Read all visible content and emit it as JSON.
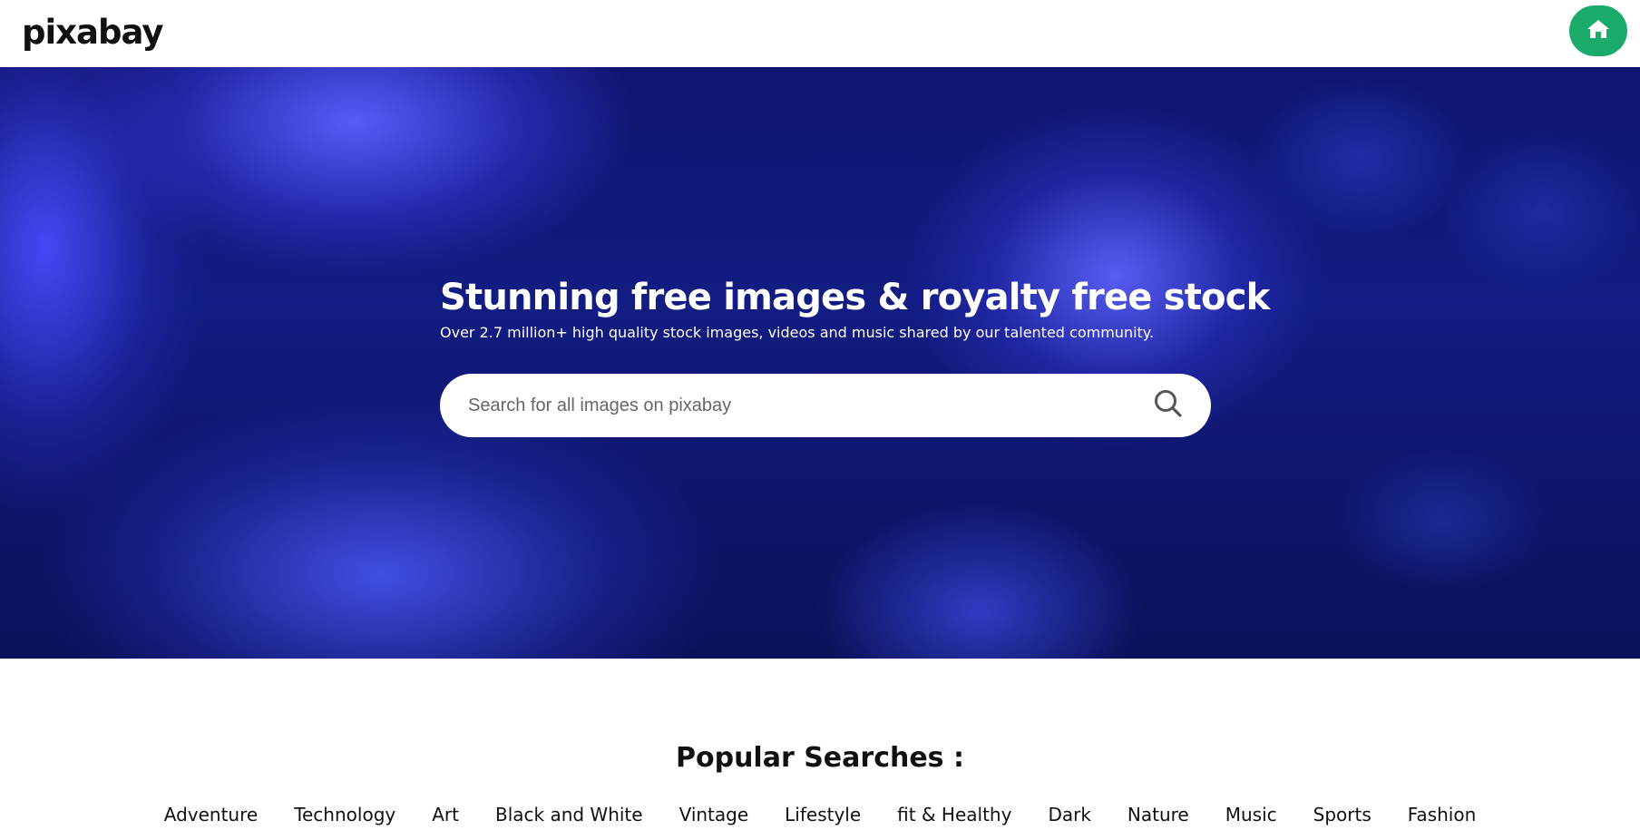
{
  "header": {
    "logo": "pixabay",
    "home_icon": "home-icon",
    "accent_color": "#1aab6b"
  },
  "hero": {
    "title": "Stunning free images & royalty free stock",
    "subtitle": "Over 2.7 million+ high quality stock images, videos and music shared by our talented community.",
    "search": {
      "placeholder": "Search for all images on pixabay",
      "value": "",
      "icon": "search-icon"
    }
  },
  "popular": {
    "title": "Popular Searches :",
    "tags": [
      "Adventure",
      "Technology",
      "Art",
      "Black and White",
      "Vintage",
      "Lifestyle",
      "fit & Healthy",
      "Dark",
      "Nature",
      "Music",
      "Sports",
      "Fashion"
    ]
  }
}
